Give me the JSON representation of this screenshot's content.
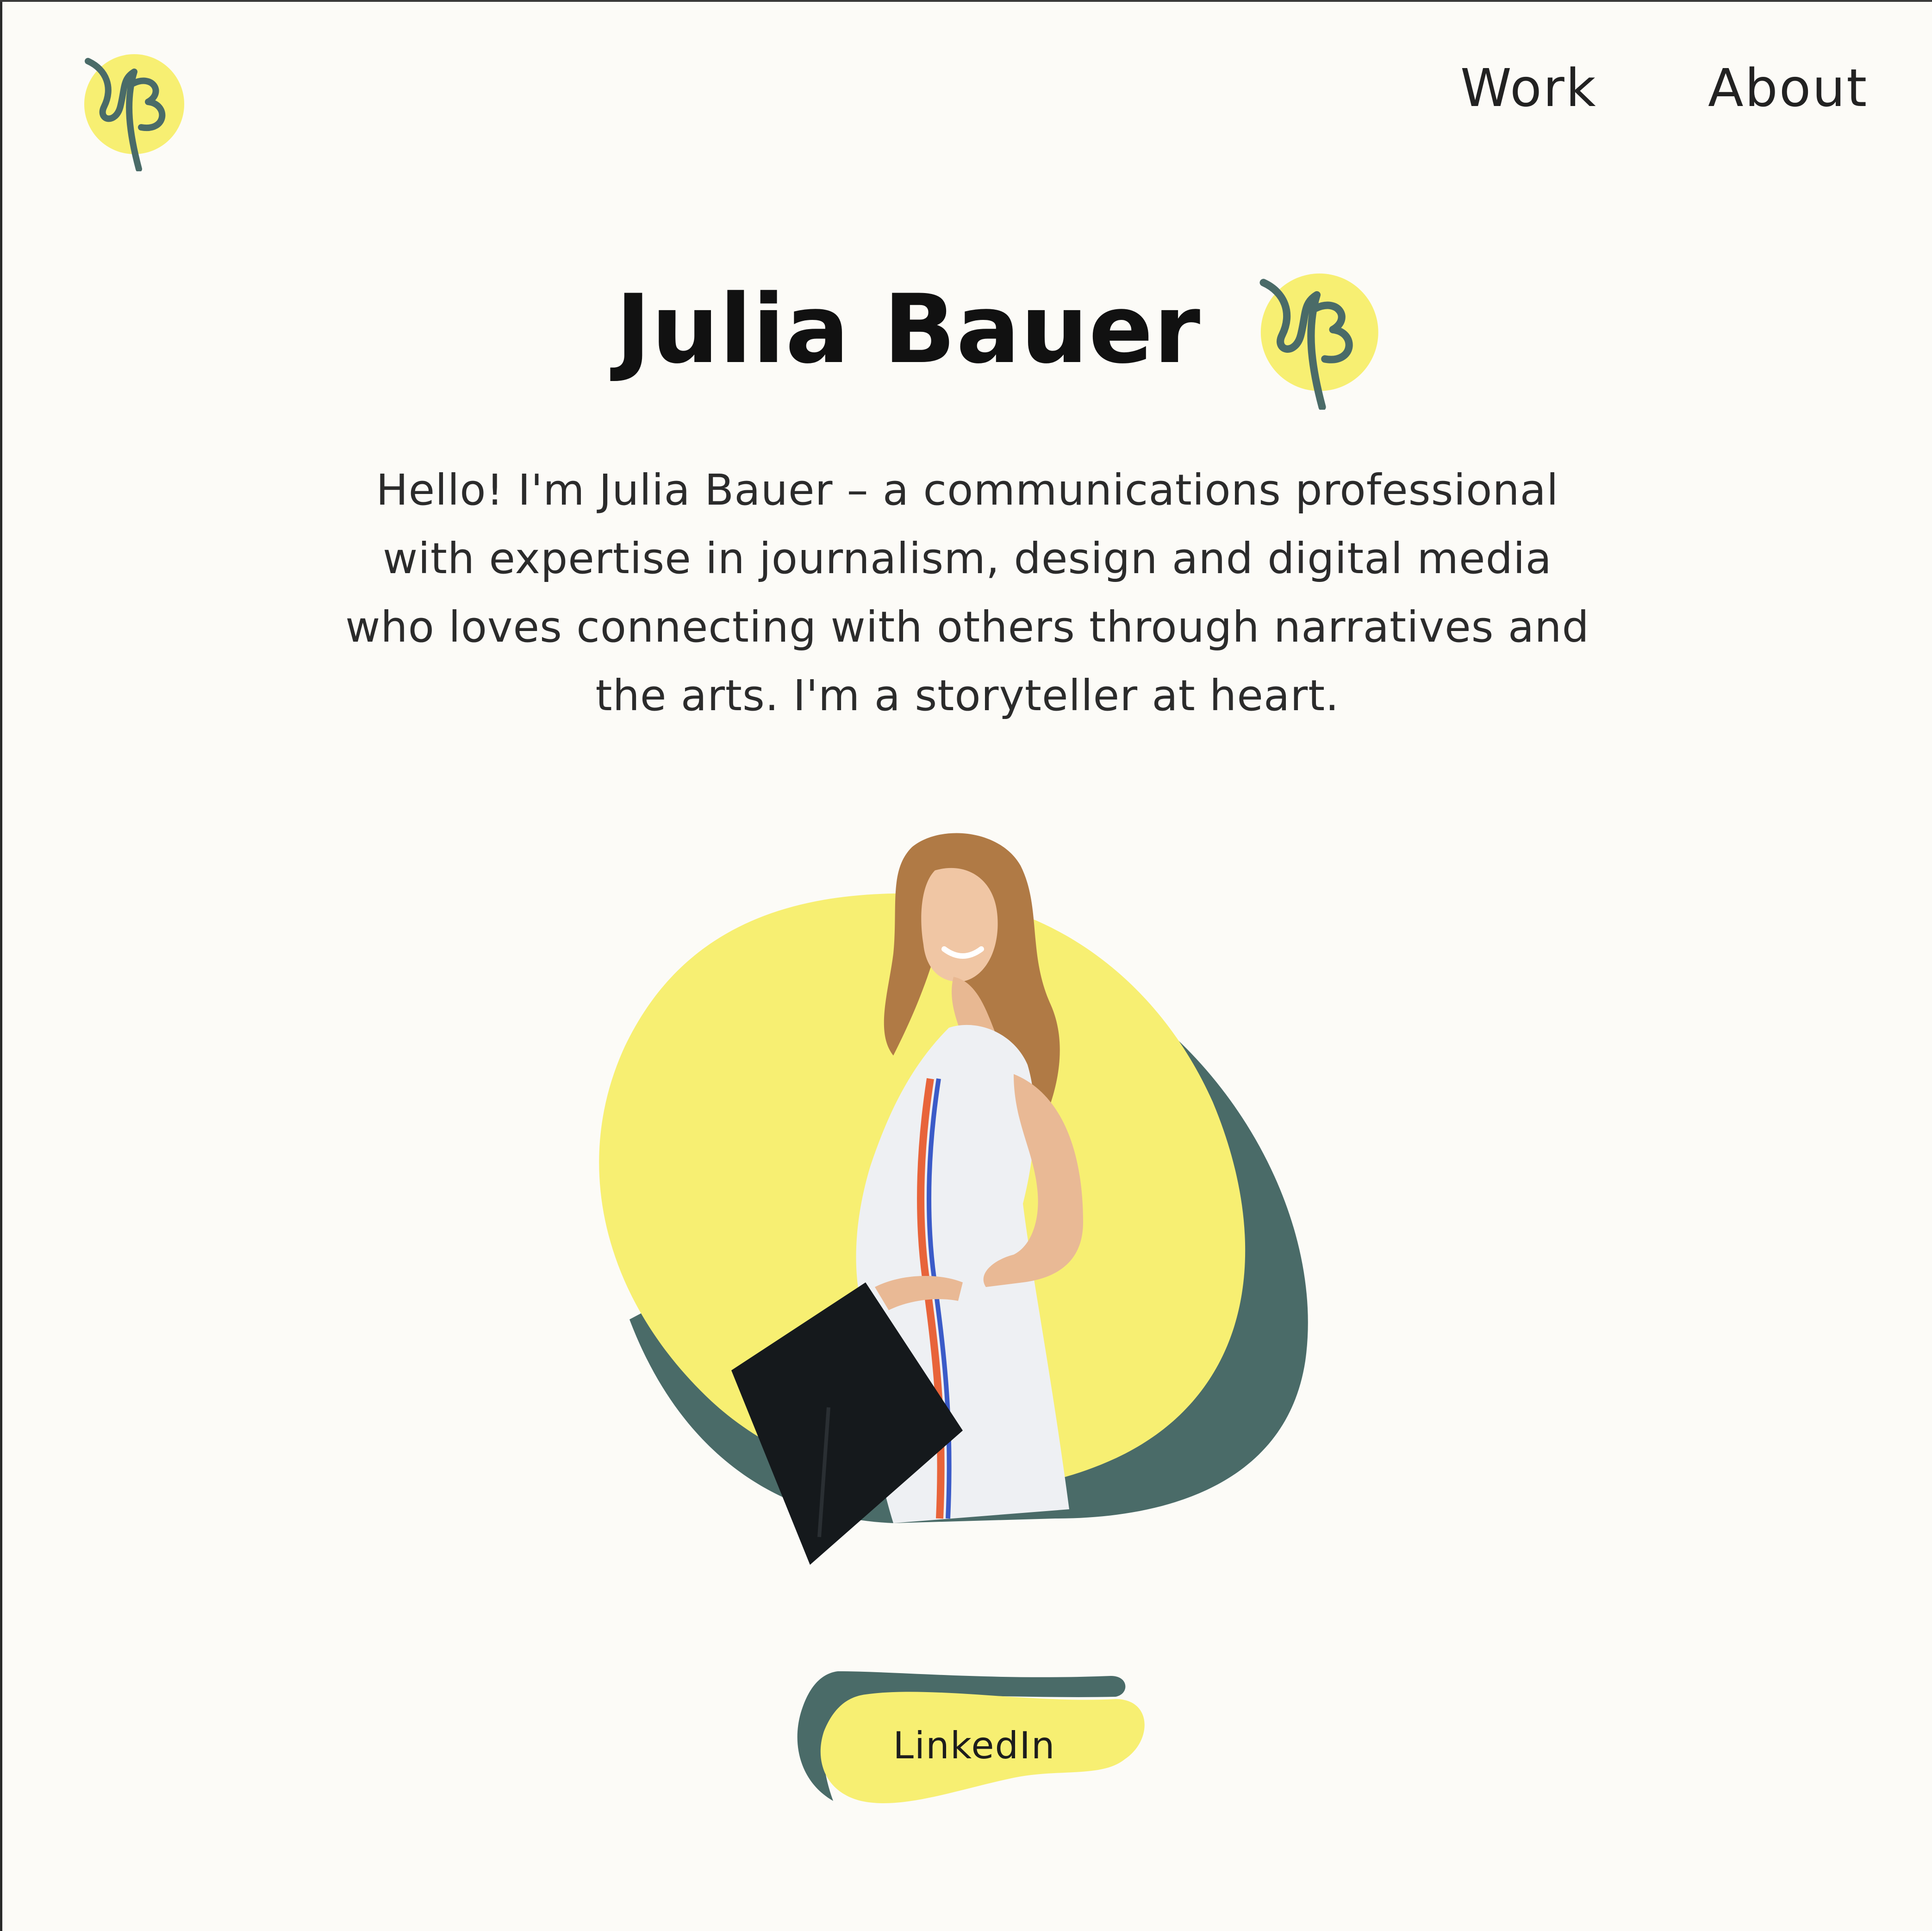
{
  "header": {
    "nav": [
      {
        "label": "Work"
      },
      {
        "label": "About"
      }
    ]
  },
  "hero": {
    "title": "Julia Bauer",
    "intro_lines": [
      "Hello! I'm Julia Bauer – a communications professional",
      "with expertise in journalism, design and digital media",
      "who loves connecting with others through narratives and",
      "the arts. I'm a storyteller at heart."
    ]
  },
  "cta": {
    "linkedin_label": "LinkedIn"
  },
  "colors": {
    "background": "#fcfbf7",
    "accent_yellow": "#f7ef72",
    "accent_teal": "#4a6b68",
    "text": "#1c1c1c"
  },
  "icons": {
    "logo": "jb-monogram-icon",
    "title_badge": "jb-monogram-icon"
  }
}
